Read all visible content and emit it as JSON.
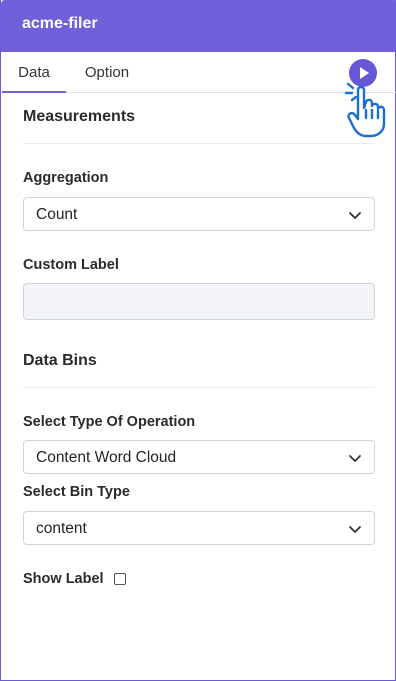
{
  "window": {
    "title": "acme-filer"
  },
  "tabs": [
    {
      "label": "Data",
      "active": true
    },
    {
      "label": "Option",
      "active": false
    }
  ],
  "measurements": {
    "heading": "Measurements",
    "aggregation_label": "Aggregation",
    "aggregation_value": "Count",
    "custom_label_label": "Custom Label",
    "custom_label_value": ""
  },
  "data_bins": {
    "heading": "Data Bins",
    "operation_label": "Select Type Of Operation",
    "operation_value": "Content Word Cloud",
    "bin_type_label": "Select Bin Type",
    "bin_type_value": "content",
    "show_label": "Show Label",
    "show_label_checked": false
  },
  "icons": {
    "run": "play-icon",
    "hand": "pointing-hand-icon",
    "dropdown": "chevron-down-icon"
  },
  "colors": {
    "accent": "#6f5fd8",
    "run_button": "#6657d6",
    "hand": "#1b6fd1"
  }
}
